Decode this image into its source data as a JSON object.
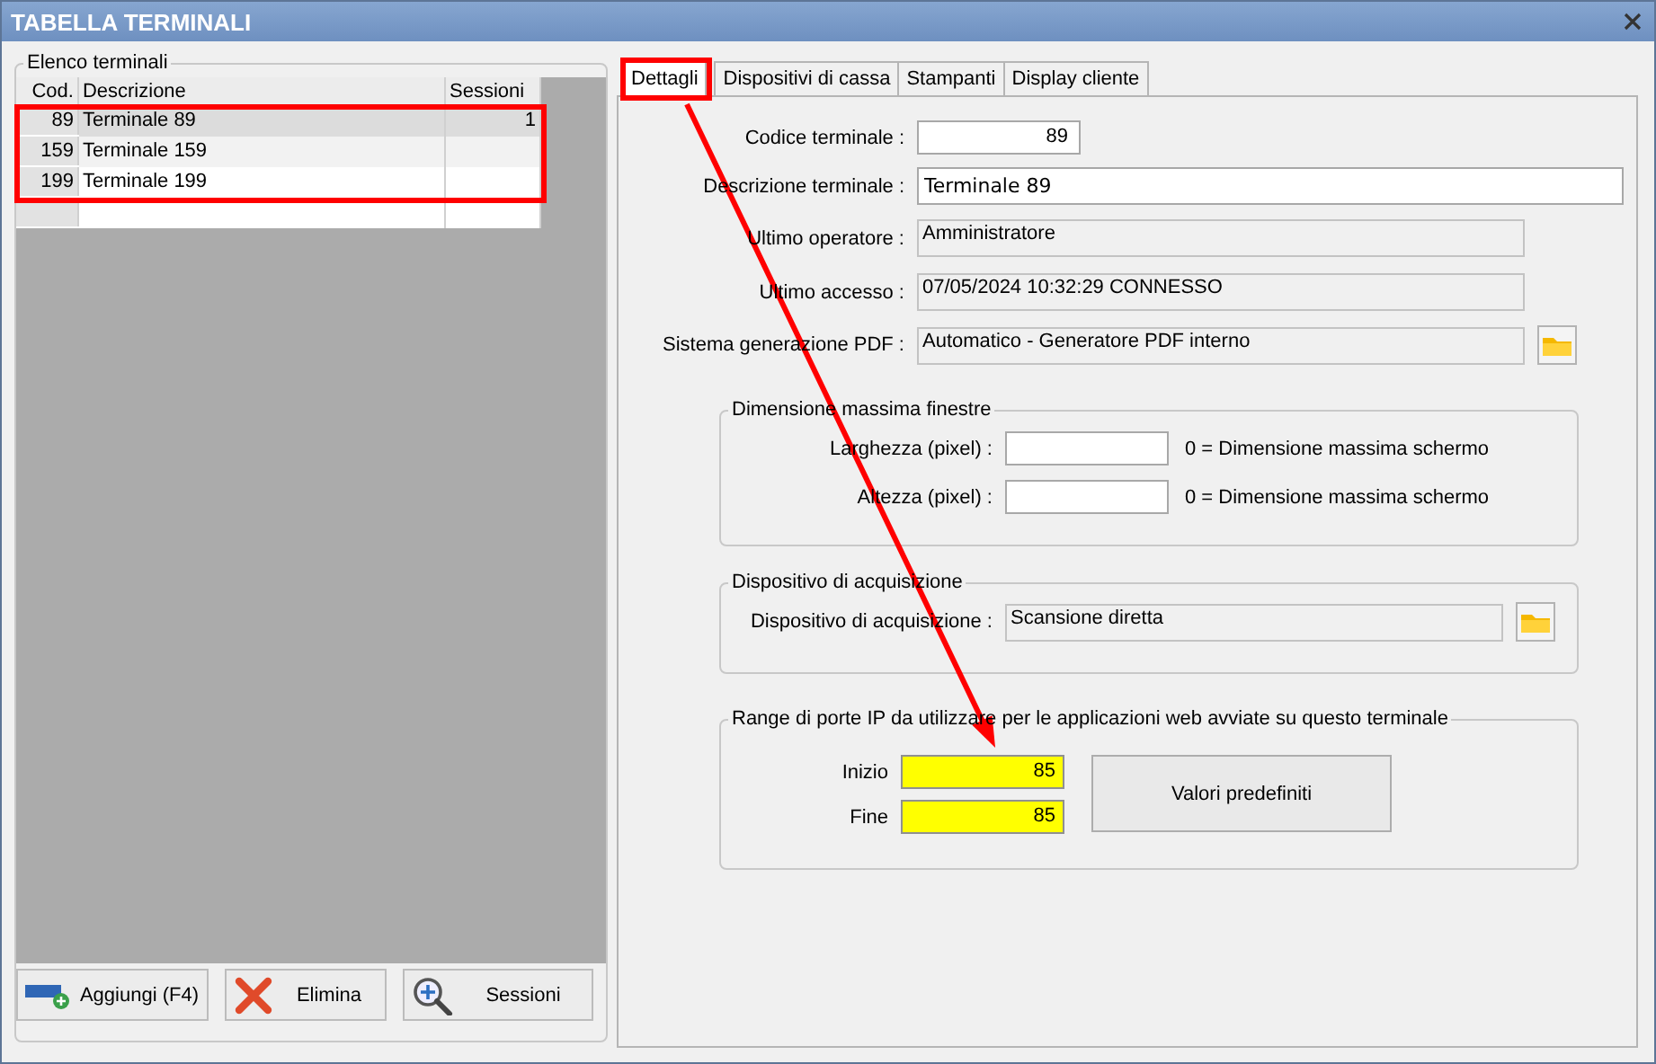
{
  "window": {
    "title": "TABELLA TERMINALI"
  },
  "terminal_list": {
    "title": "Elenco terminali",
    "columns": [
      "Cod.",
      "Descrizione",
      "Sessioni"
    ],
    "rows": [
      {
        "cod": "89",
        "descrizione": "Terminale 89",
        "sessioni": "1",
        "selected": true
      },
      {
        "cod": "159",
        "descrizione": "Terminale 159",
        "selected": false
      },
      {
        "cod": "199",
        "descrizione": "Terminale 199",
        "selected": false
      }
    ]
  },
  "list_buttons": [
    {
      "label": "Aggiungi (F4)",
      "kind": "add"
    },
    {
      "label": "Elimina",
      "kind": "delete"
    },
    {
      "label": "Sessioni",
      "kind": "sessions"
    }
  ],
  "tabs": [
    {
      "label": "Dettagli",
      "selected": true
    },
    {
      "label": "Dispositivi di cassa",
      "selected": false
    },
    {
      "label": "Stampanti",
      "selected": false
    },
    {
      "label": "Display cliente",
      "selected": false
    }
  ],
  "details": [
    {
      "label": "Codice terminale :",
      "value": "89",
      "kind": "code"
    },
    {
      "label": "Descrizione terminale :",
      "value": "Terminale 89",
      "kind": "text"
    },
    {
      "label": "Ultimo operatore :",
      "value": "Amministratore",
      "kind": "readonly"
    },
    {
      "label": "Ultimo accesso :",
      "value": "07/05/2024  10:32:29  CONNESSO",
      "kind": "readonly"
    },
    {
      "label": "Sistema generazione PDF :",
      "value": "Automatico - Generatore PDF interno",
      "kind": "browse"
    }
  ],
  "window_size": {
    "title": "Dimensione massima finestre",
    "rows": [
      {
        "label": "Larghezza (pixel) :",
        "hint": "0 = Dimensione massima schermo"
      },
      {
        "label": "Altezza (pixel) :",
        "hint": "0 = Dimensione massima schermo"
      }
    ]
  },
  "acquisition": {
    "title": "Dispositivo di acquisizione",
    "label": "Dispositivo di acquisizione :",
    "value": "Scansione diretta"
  },
  "ip_ports": {
    "title": "Range di porte IP da utilizzare per le applicazioni web avviate su questo terminale",
    "rows": [
      {
        "label": "Inizio",
        "value": "85"
      },
      {
        "label": "Fine",
        "value": "85"
      }
    ],
    "button": "Valori predefiniti"
  },
  "annotations": [
    {
      "kind": "box-rows"
    },
    {
      "kind": "box-tab"
    },
    {
      "kind": "arrow"
    }
  ]
}
